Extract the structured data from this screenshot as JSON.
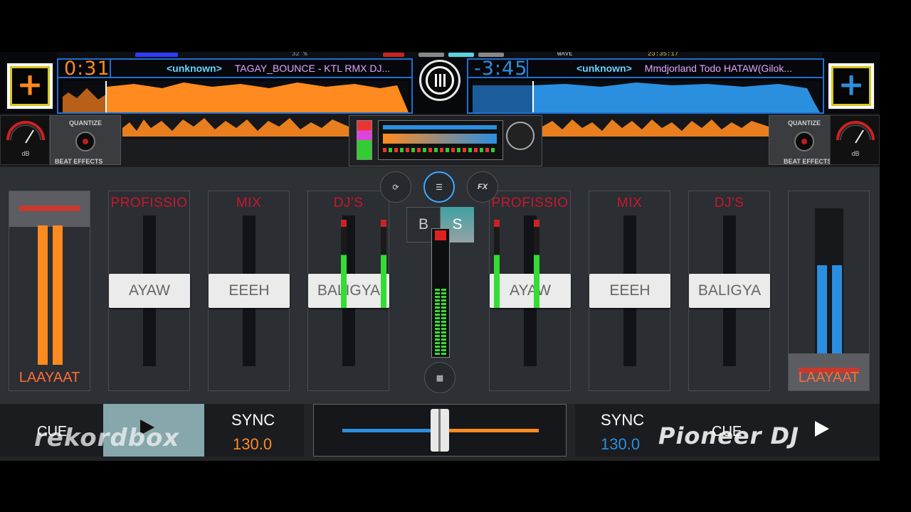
{
  "deck_a": {
    "time": "0:31",
    "tag": "<unknown>",
    "title": "TAGAY_BOUNCE - KTL RMX DJ...",
    "color": "#ff8a1f",
    "quantize_label": "QUANTIZE",
    "beat_effects_label": "BEAT EFFECTS",
    "add_icon": "plus-icon"
  },
  "deck_b": {
    "time": "-3:45",
    "tag": "<unknown>",
    "title": "Mmdjorland Todo HATAW(Gilok...",
    "color": "#2b8fe0",
    "quantize_label": "QUANTIZE",
    "beat_effects_label": "BEAT EFFECTS",
    "add_icon": "plus-icon"
  },
  "status": {
    "battery": "32 %",
    "clock": "23:35:17",
    "wave_label": "WAVE"
  },
  "mixer": {
    "channels_left": [
      {
        "name": "PROFISSIO",
        "cap": "AYAW"
      },
      {
        "name": "MIX",
        "cap": "EEEH"
      },
      {
        "name": "DJ'S",
        "cap": "BALIGYA"
      }
    ],
    "channels_right": [
      {
        "name": "PROFISSIO",
        "cap": "AYAW"
      },
      {
        "name": "MIX",
        "cap": "EEEH"
      },
      {
        "name": "DJ'S",
        "cap": "BALIGYA"
      }
    ],
    "volume_left_label": "LAAYAAT",
    "volume_right_label": "LAAYAAT",
    "bs_left": "B",
    "bs_right": "S",
    "sync_icon": "sync-icon",
    "mixer_icon": "sliders-icon",
    "fx_label": "FX",
    "grid_icon": "grid-icon"
  },
  "transport_left": {
    "cue": "CUE",
    "play_icon": "play-icon",
    "sync": "SYNC",
    "bpm": "130.0",
    "brand": "rekordbox"
  },
  "transport_right": {
    "cue": "CUE",
    "play_icon": "play-icon",
    "sync": "SYNC",
    "bpm": "130.0",
    "brand": "Pioneer DJ"
  },
  "crossfader": {
    "position": 0.5
  }
}
